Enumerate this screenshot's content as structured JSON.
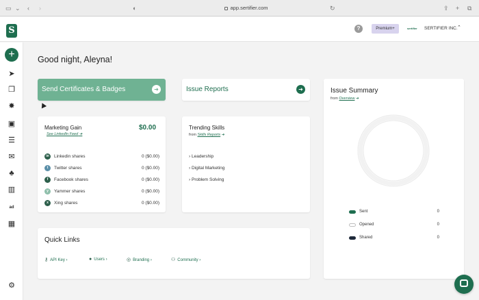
{
  "browser": {
    "url": "app.sertifier.com"
  },
  "header": {
    "logo_letter": "S",
    "help_label": "?",
    "premium_label": "Premium+",
    "company_logo_text": "sertifier",
    "company_name": "SERTIFIER INC.",
    "caret": "⌃"
  },
  "greeting": "Good night, Aleyna!",
  "send_card": {
    "label": "Send Certificates & Badges"
  },
  "issue_card": {
    "label": "Issue Reports"
  },
  "marketing": {
    "title": "Marketing Gain",
    "amount": "$0.00",
    "link": "See LinkedIn Feed",
    "shares": [
      {
        "name": "Linkedin shares",
        "value": "0 ($0.00)",
        "icon": "in",
        "color": "#0a66c2"
      },
      {
        "name": "Twitter shares",
        "value": "0 ($0.00)",
        "icon": "t",
        "color": "#1da1f2"
      },
      {
        "name": "Facebook shares",
        "value": "0 ($0.00)",
        "icon": "f",
        "color": "#1877f2"
      },
      {
        "name": "Yammer shares",
        "value": "0 ($0.00)",
        "icon": "y",
        "color": "#5aa1b8"
      },
      {
        "name": "Xing shares",
        "value": "0 ($0.00)",
        "icon": "x",
        "color": "#0c6b58"
      }
    ]
  },
  "trending": {
    "title": "Trending Skills",
    "from_prefix": "from",
    "from_link": "Skills Reports",
    "items": [
      "Leadership",
      "Digital Marketing",
      "Problem Solving"
    ]
  },
  "quick_links": {
    "title": "Quick Links",
    "items": [
      {
        "label": "API Key",
        "icon": "key-icon"
      },
      {
        "label": "Users",
        "icon": "user-icon"
      },
      {
        "label": "Branding",
        "icon": "fingerprint-icon"
      },
      {
        "label": "Community",
        "icon": "community-icon"
      }
    ]
  },
  "summary": {
    "title": "Issue Summary",
    "from_prefix": "from",
    "from_link": "Overview",
    "legend": [
      {
        "label": "Sent",
        "value": "0",
        "color": "#1e6e4f"
      },
      {
        "label": "Opened",
        "value": "0",
        "color": "#d8d8d8"
      },
      {
        "label": "Shared",
        "value": "0",
        "color": "#1f2a3a"
      }
    ]
  },
  "colors": {
    "brand": "#1e6e4f",
    "send_card_bg": "#6fb293",
    "premium_bg": "#d8d3ee"
  }
}
